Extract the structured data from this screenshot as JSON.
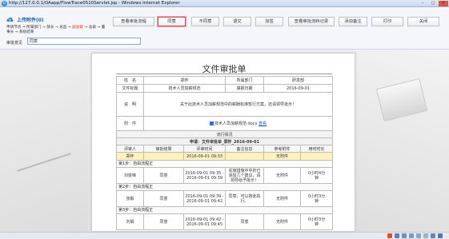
{
  "window": {
    "title": "http://127.0.0.1/OAapp/FlowTrace0510Servlet.jsp - Windows Internet Explorer",
    "min": "–",
    "max": "□",
    "close": "✕"
  },
  "header": {
    "app_title": "上传附件(0)",
    "flow_line1_a": "申请节点 → 所属部门 → 部长 → 总监 → ",
    "flow_line1_cur": "副总裁",
    "flow_line1_b": " → 总裁 → 董",
    "flow_line2": "事长 → 系统结束",
    "feedback_label": "审批意见",
    "feedback_value": "同意"
  },
  "toolbar": [
    "查看审批流程",
    "同意",
    "不同意",
    "退交",
    "加签",
    "查看审批流转记录",
    "添加备注",
    "打印",
    "关闭"
  ],
  "document": {
    "title": "文件审批单",
    "row1": [
      "姓　名",
      "郑怀",
      "所属部门",
      "研发部"
    ],
    "row2": [
      "文件标题",
      "技术人员加薪规范",
      "填报日期",
      "2016-09-01"
    ],
    "row3": [
      "说　明",
      "关于此技术人员加薪规范中的薪酬标准暂行方案，还请领导批示！"
    ],
    "row4_label": "附　件",
    "attachment_name": "技术人员加薪规范.docx",
    "attachment_link": "查看",
    "section": "流行情况",
    "apply_line": "申请：文件审批单_郑怀_2016-09-01",
    "cols": [
      "评审人",
      "审批结果",
      "评审时间",
      "备注信息",
      "参考附件",
      "用时时长"
    ],
    "rows": [
      {
        "type": "hi",
        "c": [
          "郑怀",
          "",
          "2016-09-01 09:33",
          "",
          "无附件",
          ""
        ]
      },
      {
        "type": "step",
        "c": [
          "第1步：自由流程正"
        ]
      },
      {
        "type": "r",
        "c": [
          "刘俊锋",
          "同意",
          "2016-09-01 09:35 -\n2016-09-01 09:39",
          "实施措施中中的已\n添加几个建议，请\n领导给予批示！",
          "无附件",
          "0小时4分\n钟"
        ]
      },
      {
        "type": "step",
        "c": [
          "第2步：自由流程正"
        ]
      },
      {
        "type": "r",
        "c": [
          "张毅",
          "同意",
          "2016-09-01 09:39 -\n2016-09-01 09:42",
          "同意，可以按此执\n行。",
          "无附件",
          "0小时3分\n钟"
        ]
      },
      {
        "type": "step",
        "c": [
          "第3步：自由流程正"
        ]
      },
      {
        "type": "r",
        "c": [
          "刘娟",
          "同意",
          "2016-09-01 09:42 -\n2016-09-01 09:45",
          "同意",
          "无附件",
          "0小时3分\n钟"
        ]
      }
    ]
  },
  "colors": {
    "accent": "#1f5fa6",
    "highlight": "#fbf3b9",
    "selected_border": "#e04a4a"
  }
}
